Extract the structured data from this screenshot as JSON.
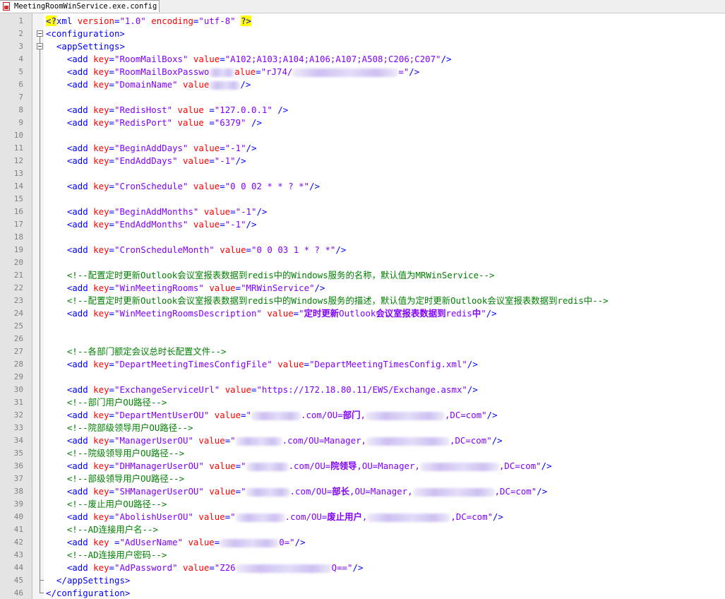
{
  "tab": {
    "title": "MeetingRoomWinService.exe.config",
    "icon": "config-file-icon"
  },
  "colors": {
    "tag": "#0000ff",
    "attr": "#ff0000",
    "value": "#8000ff",
    "comment": "#008000",
    "pi_highlight": "#ffff00"
  },
  "lines": [
    {
      "n": "1",
      "parts": [
        [
          "pi",
          "<?"
        ],
        [
          "tag",
          "xml "
        ],
        [
          "attr",
          "version"
        ],
        [
          "tag",
          "="
        ],
        [
          "val",
          "\"1.0\""
        ],
        [
          "tag",
          " "
        ],
        [
          "attr",
          "encoding"
        ],
        [
          "tag",
          "="
        ],
        [
          "val",
          "\"utf-8\""
        ],
        [
          "tag",
          " "
        ],
        [
          "pi",
          "?>"
        ]
      ]
    },
    {
      "n": "2",
      "fold": "box",
      "parts": [
        [
          "tag",
          "<configuration>"
        ]
      ]
    },
    {
      "n": "3",
      "fold": "box",
      "indent": "  ",
      "parts": [
        [
          "tag",
          "<appSettings>"
        ]
      ]
    },
    {
      "n": "4",
      "fold": "line",
      "indent": "    ",
      "parts": [
        [
          "tag",
          "<add "
        ],
        [
          "attr",
          "key"
        ],
        [
          "tag",
          "="
        ],
        [
          "val",
          "\"RoomMailBoxs\""
        ],
        [
          "tag",
          " "
        ],
        [
          "attr",
          "value"
        ],
        [
          "tag",
          "="
        ],
        [
          "val",
          "\"A102;A103;A104;A106;A107;A508;C206;C207\""
        ],
        [
          "tag",
          "/>"
        ]
      ]
    },
    {
      "n": "5",
      "fold": "line",
      "indent": "    ",
      "parts": [
        [
          "tag",
          "<add "
        ],
        [
          "attr",
          "key"
        ],
        [
          "tag",
          "="
        ],
        [
          "val",
          "\"RoomMailBoxPasswo"
        ],
        [
          "blur",
          "36"
        ],
        [
          "attr",
          "alue"
        ],
        [
          "tag",
          "="
        ],
        [
          "val",
          "\"rJ74/"
        ],
        [
          "blur",
          "150"
        ],
        [
          "val",
          "=\""
        ],
        [
          "tag",
          "/>"
        ]
      ]
    },
    {
      "n": "6",
      "fold": "line",
      "indent": "    ",
      "parts": [
        [
          "tag",
          "<add "
        ],
        [
          "attr",
          "key"
        ],
        [
          "tag",
          "="
        ],
        [
          "val",
          "\"DomainName\""
        ],
        [
          "tag",
          " "
        ],
        [
          "attr",
          "value"
        ],
        [
          "blur",
          "44"
        ],
        [
          "tag",
          "/>"
        ]
      ]
    },
    {
      "n": "7",
      "fold": "line",
      "parts": []
    },
    {
      "n": "8",
      "fold": "line",
      "indent": "    ",
      "parts": [
        [
          "tag",
          "<add "
        ],
        [
          "attr",
          "key"
        ],
        [
          "tag",
          "="
        ],
        [
          "val",
          "\"RedisHost\""
        ],
        [
          "tag",
          " "
        ],
        [
          "attr",
          "value"
        ],
        [
          "tag",
          " ="
        ],
        [
          "val",
          "\"127.0.0.1\""
        ],
        [
          "tag",
          " />"
        ]
      ]
    },
    {
      "n": "9",
      "fold": "line",
      "indent": "    ",
      "parts": [
        [
          "tag",
          "<add "
        ],
        [
          "attr",
          "key"
        ],
        [
          "tag",
          "="
        ],
        [
          "val",
          "\"RedisPort\""
        ],
        [
          "tag",
          " "
        ],
        [
          "attr",
          "value"
        ],
        [
          "tag",
          " ="
        ],
        [
          "val",
          "\"6379\""
        ],
        [
          "tag",
          " />"
        ]
      ]
    },
    {
      "n": "10",
      "fold": "line",
      "parts": []
    },
    {
      "n": "11",
      "fold": "line",
      "indent": "    ",
      "parts": [
        [
          "tag",
          "<add "
        ],
        [
          "attr",
          "key"
        ],
        [
          "tag",
          "="
        ],
        [
          "val",
          "\"BeginAddDays\""
        ],
        [
          "tag",
          " "
        ],
        [
          "attr",
          "value"
        ],
        [
          "tag",
          "="
        ],
        [
          "val",
          "\"-1\""
        ],
        [
          "tag",
          "/>"
        ]
      ]
    },
    {
      "n": "12",
      "fold": "line",
      "indent": "    ",
      "parts": [
        [
          "tag",
          "<add "
        ],
        [
          "attr",
          "key"
        ],
        [
          "tag",
          "="
        ],
        [
          "val",
          "\"EndAddDays\""
        ],
        [
          "tag",
          " "
        ],
        [
          "attr",
          "value"
        ],
        [
          "tag",
          "="
        ],
        [
          "val",
          "\"-1\""
        ],
        [
          "tag",
          "/>"
        ]
      ]
    },
    {
      "n": "13",
      "fold": "line",
      "parts": []
    },
    {
      "n": "14",
      "fold": "line",
      "indent": "    ",
      "parts": [
        [
          "tag",
          "<add "
        ],
        [
          "attr",
          "key"
        ],
        [
          "tag",
          "="
        ],
        [
          "val",
          "\"CronSchedule\""
        ],
        [
          "tag",
          " "
        ],
        [
          "attr",
          "value"
        ],
        [
          "tag",
          "="
        ],
        [
          "val",
          "\"0 0 02 * * ? *\""
        ],
        [
          "tag",
          "/>"
        ]
      ]
    },
    {
      "n": "15",
      "fold": "line",
      "parts": []
    },
    {
      "n": "16",
      "fold": "line",
      "indent": "    ",
      "parts": [
        [
          "tag",
          "<add "
        ],
        [
          "attr",
          "key"
        ],
        [
          "tag",
          "="
        ],
        [
          "val",
          "\"BeginAddMonths\""
        ],
        [
          "tag",
          " "
        ],
        [
          "attr",
          "value"
        ],
        [
          "tag",
          "="
        ],
        [
          "val",
          "\"-1\""
        ],
        [
          "tag",
          "/>"
        ]
      ]
    },
    {
      "n": "17",
      "fold": "line",
      "indent": "    ",
      "parts": [
        [
          "tag",
          "<add "
        ],
        [
          "attr",
          "key"
        ],
        [
          "tag",
          "="
        ],
        [
          "val",
          "\"EndAddMonths\""
        ],
        [
          "tag",
          " "
        ],
        [
          "attr",
          "value"
        ],
        [
          "tag",
          "="
        ],
        [
          "val",
          "\"-1\""
        ],
        [
          "tag",
          "/>"
        ]
      ]
    },
    {
      "n": "18",
      "fold": "line",
      "parts": []
    },
    {
      "n": "19",
      "fold": "line",
      "indent": "    ",
      "parts": [
        [
          "tag",
          "<add "
        ],
        [
          "attr",
          "key"
        ],
        [
          "tag",
          "="
        ],
        [
          "val",
          "\"CronScheduleMonth\""
        ],
        [
          "tag",
          " "
        ],
        [
          "attr",
          "value"
        ],
        [
          "tag",
          "="
        ],
        [
          "val",
          "\"0 0 03 1 * ? *\""
        ],
        [
          "tag",
          "/>"
        ]
      ]
    },
    {
      "n": "20",
      "fold": "line",
      "parts": []
    },
    {
      "n": "21",
      "fold": "line",
      "indent": "    ",
      "parts": [
        [
          "cmt",
          "<!--配置定时更新Outlook会议室报表数据到redis中的Windows服务的名称，默认值为MRWinService-->"
        ]
      ]
    },
    {
      "n": "22",
      "fold": "line",
      "indent": "    ",
      "parts": [
        [
          "tag",
          "<add "
        ],
        [
          "attr",
          "key"
        ],
        [
          "tag",
          "="
        ],
        [
          "val",
          "\"WinMeetingRooms\""
        ],
        [
          "tag",
          " "
        ],
        [
          "attr",
          "value"
        ],
        [
          "tag",
          "="
        ],
        [
          "val",
          "\"MRWinService\""
        ],
        [
          "tag",
          "/>"
        ]
      ]
    },
    {
      "n": "23",
      "fold": "line",
      "indent": "    ",
      "parts": [
        [
          "cmt",
          "<!--配置定时更新Outlook会议室报表数据到redis中的Windows服务的描述，默认值为定时更新Outlook会议室报表数据到redis中-->"
        ]
      ]
    },
    {
      "n": "24",
      "fold": "line",
      "indent": "    ",
      "parts": [
        [
          "tag",
          "<add "
        ],
        [
          "attr",
          "key"
        ],
        [
          "tag",
          "="
        ],
        [
          "val",
          "\"WinMeetingRoomsDescription\""
        ],
        [
          "tag",
          " "
        ],
        [
          "attr",
          "value"
        ],
        [
          "tag",
          "="
        ],
        [
          "val",
          "\""
        ],
        [
          "valb",
          "定时更新"
        ],
        [
          "val",
          "Outlook"
        ],
        [
          "valb",
          "会议室报表数据到"
        ],
        [
          "val",
          "redis"
        ],
        [
          "valb",
          "中"
        ],
        [
          "val",
          "\""
        ],
        [
          "tag",
          "/>"
        ]
      ]
    },
    {
      "n": "25",
      "fold": "line",
      "parts": []
    },
    {
      "n": "26",
      "fold": "line",
      "parts": []
    },
    {
      "n": "27",
      "fold": "line",
      "indent": "    ",
      "parts": [
        [
          "cmt",
          "<!--各部门额定会议总时长配置文件-->"
        ]
      ]
    },
    {
      "n": "28",
      "fold": "line",
      "indent": "    ",
      "parts": [
        [
          "tag",
          "<add "
        ],
        [
          "attr",
          "key"
        ],
        [
          "tag",
          "="
        ],
        [
          "val",
          "\"DepartMeetingTimesConfigFile\""
        ],
        [
          "tag",
          " "
        ],
        [
          "attr",
          "value"
        ],
        [
          "tag",
          "="
        ],
        [
          "val",
          "\"DepartMeetingTimesConfig.xml\""
        ],
        [
          "tag",
          "/>"
        ]
      ]
    },
    {
      "n": "29",
      "fold": "line",
      "parts": []
    },
    {
      "n": "30",
      "fold": "line",
      "indent": "    ",
      "parts": [
        [
          "tag",
          "<add "
        ],
        [
          "attr",
          "key"
        ],
        [
          "tag",
          "="
        ],
        [
          "val",
          "\"ExchangeServiceUrl\""
        ],
        [
          "tag",
          " "
        ],
        [
          "attr",
          "value"
        ],
        [
          "tag",
          "="
        ],
        [
          "val",
          "\"https://172.18.80.11/EWS/Exchange.asmx\""
        ],
        [
          "tag",
          "/>"
        ]
      ]
    },
    {
      "n": "31",
      "fold": "line",
      "indent": "    ",
      "parts": [
        [
          "cmt",
          "<!--部门用户OU路径-->"
        ]
      ]
    },
    {
      "n": "32",
      "fold": "line",
      "indent": "    ",
      "parts": [
        [
          "tag",
          "<add "
        ],
        [
          "attr",
          "key"
        ],
        [
          "tag",
          "="
        ],
        [
          "val",
          "\"DepartMentUserOU\""
        ],
        [
          "tag",
          " "
        ],
        [
          "attr",
          "value"
        ],
        [
          "tag",
          "="
        ],
        [
          "val",
          "\""
        ],
        [
          "blur",
          "70"
        ],
        [
          "val",
          ".com/OU="
        ],
        [
          "valb",
          "部门"
        ],
        [
          "val",
          ","
        ],
        [
          "blur",
          "112"
        ],
        [
          "val",
          ",DC=com\""
        ],
        [
          "tag",
          "/>"
        ]
      ]
    },
    {
      "n": "33",
      "fold": "line",
      "indent": "    ",
      "parts": [
        [
          "cmt",
          "<!--院部级领导用户OU路径-->"
        ]
      ]
    },
    {
      "n": "34",
      "fold": "line",
      "indent": "    ",
      "parts": [
        [
          "tag",
          "<add "
        ],
        [
          "attr",
          "key"
        ],
        [
          "tag",
          "="
        ],
        [
          "val",
          "\"ManagerUserOU\""
        ],
        [
          "tag",
          " "
        ],
        [
          "attr",
          "value"
        ],
        [
          "tag",
          "="
        ],
        [
          "val",
          "\""
        ],
        [
          "blur",
          "66"
        ],
        [
          "val",
          ".com/OU=Manager,"
        ],
        [
          "blur",
          "118"
        ],
        [
          "val",
          ",DC=com\""
        ],
        [
          "tag",
          "/>"
        ]
      ]
    },
    {
      "n": "35",
      "fold": "line",
      "indent": "    ",
      "parts": [
        [
          "cmt",
          "<!--院级领导用户OU路径-->"
        ]
      ]
    },
    {
      "n": "36",
      "fold": "line",
      "indent": "    ",
      "parts": [
        [
          "tag",
          "<add "
        ],
        [
          "attr",
          "key"
        ],
        [
          "tag",
          "="
        ],
        [
          "val",
          "\"DHManagerUserOU\""
        ],
        [
          "tag",
          " "
        ],
        [
          "attr",
          "value"
        ],
        [
          "tag",
          "="
        ],
        [
          "val",
          "\""
        ],
        [
          "blur",
          "60"
        ],
        [
          "val",
          ".com/OU="
        ],
        [
          "valb",
          "院领导"
        ],
        [
          "val",
          ",OU=Manager,"
        ],
        [
          "blur",
          "112"
        ],
        [
          "val",
          ",DC=com\""
        ],
        [
          "tag",
          "/>"
        ]
      ]
    },
    {
      "n": "37",
      "fold": "line",
      "indent": "    ",
      "parts": [
        [
          "cmt",
          "<!--部级领导用户OU路径-->"
        ]
      ]
    },
    {
      "n": "38",
      "fold": "line",
      "indent": "    ",
      "parts": [
        [
          "tag",
          "<add "
        ],
        [
          "attr",
          "key"
        ],
        [
          "tag",
          "="
        ],
        [
          "val",
          "\""
        ],
        [
          "val",
          "SHManagerUserOU\""
        ],
        [
          "tag",
          " "
        ],
        [
          "attr",
          "value"
        ],
        [
          "tag",
          "="
        ],
        [
          "val",
          "\""
        ],
        [
          "blur",
          "62"
        ],
        [
          "val",
          ".com/OU="
        ],
        [
          "valb",
          "部长"
        ],
        [
          "val",
          ",OU=Manager,"
        ],
        [
          "blur",
          "116"
        ],
        [
          "val",
          ",DC=com\""
        ],
        [
          "tag",
          "/>"
        ]
      ]
    },
    {
      "n": "39",
      "fold": "line",
      "indent": "    ",
      "parts": [
        [
          "cmt",
          "<!--废止用户OU路径-->"
        ]
      ]
    },
    {
      "n": "40",
      "fold": "line",
      "indent": "    ",
      "parts": [
        [
          "tag",
          "<add "
        ],
        [
          "attr",
          "key"
        ],
        [
          "tag",
          "="
        ],
        [
          "val",
          "\"AbolishUserOU\""
        ],
        [
          "tag",
          " "
        ],
        [
          "attr",
          "value"
        ],
        [
          "tag",
          "="
        ],
        [
          "val",
          "\""
        ],
        [
          "blur",
          "70"
        ],
        [
          "val",
          ".com/OU="
        ],
        [
          "valb",
          "废止用户"
        ],
        [
          "val",
          ","
        ],
        [
          "blur",
          "118"
        ],
        [
          "val",
          ",DC=com\""
        ],
        [
          "tag",
          "/>"
        ]
      ]
    },
    {
      "n": "41",
      "fold": "line",
      "indent": "    ",
      "parts": [
        [
          "cmt",
          "<!--AD连接用户名-->"
        ]
      ]
    },
    {
      "n": "42",
      "fold": "line",
      "indent": "    ",
      "parts": [
        [
          "tag",
          "<add "
        ],
        [
          "attr",
          "key"
        ],
        [
          "tag",
          " ="
        ],
        [
          "val",
          "\"AdUserName\""
        ],
        [
          "tag",
          " "
        ],
        [
          "attr",
          "value"
        ],
        [
          "tag",
          "="
        ],
        [
          "blur",
          "84"
        ],
        [
          "val",
          "0=\""
        ],
        [
          "tag",
          "/>"
        ]
      ]
    },
    {
      "n": "43",
      "fold": "line",
      "indent": "    ",
      "parts": [
        [
          "cmt",
          "<!--AD连接用户密码-->"
        ]
      ]
    },
    {
      "n": "44",
      "fold": "line",
      "indent": "    ",
      "parts": [
        [
          "tag",
          "<add "
        ],
        [
          "attr",
          "key"
        ],
        [
          "tag",
          "="
        ],
        [
          "val",
          "\"AdPassword\""
        ],
        [
          "tag",
          " "
        ],
        [
          "attr",
          "value"
        ],
        [
          "tag",
          "="
        ],
        [
          "val",
          "\"Z26"
        ],
        [
          "blur",
          "136"
        ],
        [
          "val",
          "Q==\""
        ],
        [
          "tag",
          "/>"
        ]
      ]
    },
    {
      "n": "45",
      "fold": "end-inner",
      "indent": "  ",
      "parts": [
        [
          "tag",
          "</appSettings>"
        ]
      ]
    },
    {
      "n": "46",
      "fold": "end",
      "parts": [
        [
          "tag",
          "</configuration>"
        ]
      ]
    }
  ]
}
